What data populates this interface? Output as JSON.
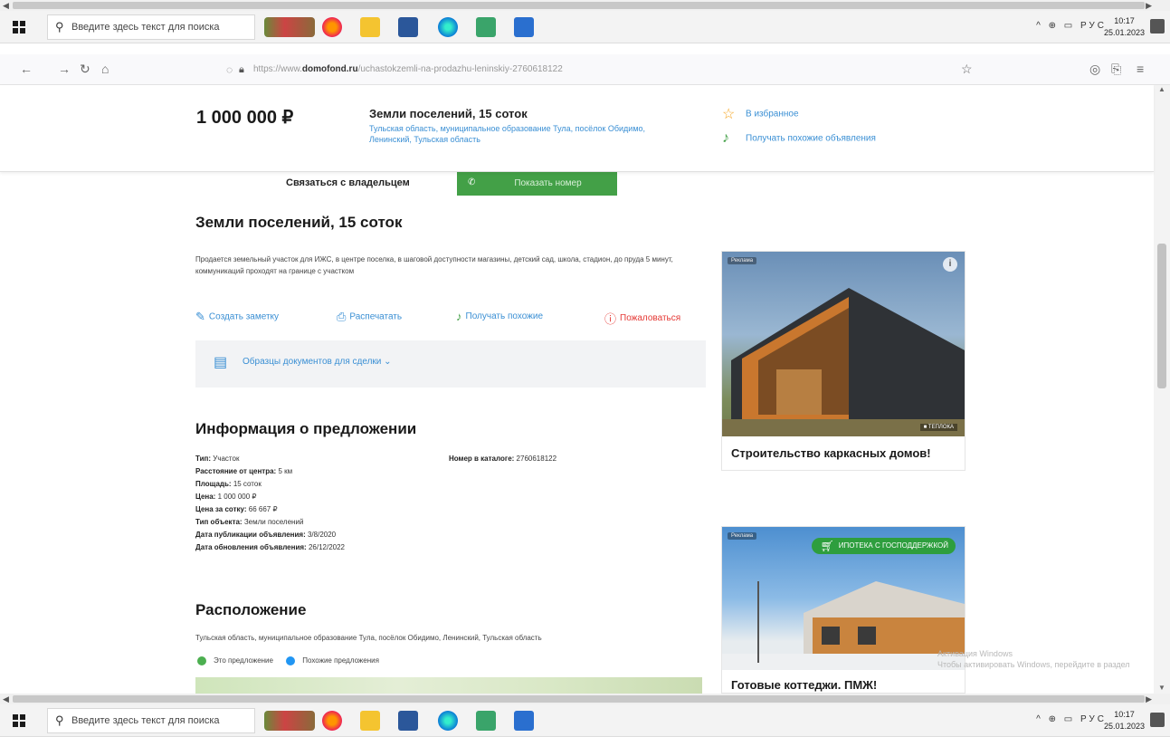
{
  "taskbar": {
    "search_placeholder": "Введите здесь текст для поиска",
    "tray_lang": "РУС",
    "clock_time": "10:17",
    "clock_date": "25.01.2023"
  },
  "browser": {
    "url_prefix": "https://www.",
    "url_domain": "domofond.ru",
    "url_path": "/uchastokzemli-na-prodazhu-leninskiy-2760618122"
  },
  "sticky": {
    "price": "1 000 000 ₽",
    "title": "Земли поселений, 15 соток",
    "address": "Тульская область, муниципальное образование Тула, посёлок Обидимо, Ленинский, Тульская область",
    "favorite_label": "В избранное",
    "similar_label": "Получать похожие объявления"
  },
  "contact": {
    "label": "Связаться с владельцем",
    "phone_button": "Показать номер"
  },
  "listing": {
    "title": "Земли поселений, 15 соток",
    "description": "Продается земельный участок для ИЖС, в центре поселка, в шаговой доступности магазины, детский сад, школа, стадион, до пруда 5 минут, коммуникаций проходят на границе с участком"
  },
  "actions": {
    "note": "Создать заметку",
    "print": "Распечатать",
    "similar": "Получать похожие",
    "report": "Пожаловаться"
  },
  "docs": {
    "label": "Образцы документов для сделки"
  },
  "offer": {
    "heading": "Информация о предложении",
    "type_k": "Тип:",
    "type_v": "Участок",
    "distance_k": "Расстояние от центра:",
    "distance_v": "5 км",
    "area_k": "Площадь:",
    "area_v": "15 соток",
    "price_k": "Цена:",
    "price_v": "1 000 000 ₽",
    "price_per_k": "Цена за сотку:",
    "price_per_v": "66 667 ₽",
    "object_k": "Тип объекта:",
    "object_v": "Земли поселений",
    "published_k": "Дата публикации объявления:",
    "published_v": "3/8/2020",
    "updated_k": "Дата обновления объявления:",
    "updated_v": "26/12/2022",
    "catalog_k": "Номер в каталоге:",
    "catalog_v": "2760618122"
  },
  "location": {
    "heading": "Расположение",
    "address": "Тульская область, муниципальное образование Тула, посёлок Обидимо, Ленинский, Тульская область",
    "legend_this": "Это предложение",
    "legend_similar": "Похожие предложения",
    "color_this": "#4caf50",
    "color_similar": "#2196f3"
  },
  "ads": {
    "ad1_tag": "Реклама",
    "ad1_caption": "Строительство каркасных домов!",
    "ad1_photo_label": "■ ТЕПЛОКА",
    "ad2_tag": "Реклама",
    "ad2_badge": "ИПОТЕКА С ГОСПОДДЕРЖКОЙ",
    "ad2_caption": "Готовые коттеджи. ПМЖ!"
  },
  "watermark": {
    "line1": "Активация Windows",
    "line2": "Чтобы активировать Windows, перейдите в раздел"
  },
  "colors": {
    "accent": "#3a8fd4",
    "green": "#43a047"
  }
}
